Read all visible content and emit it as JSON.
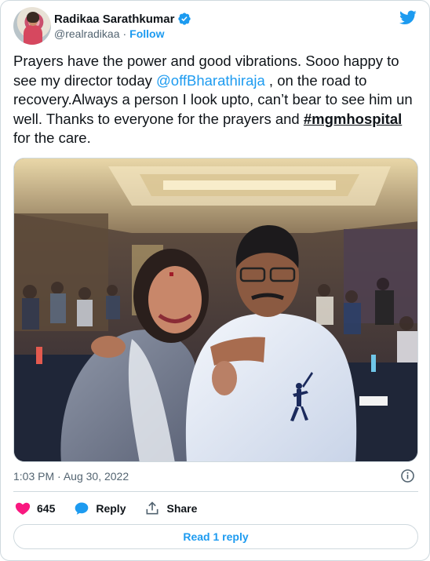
{
  "author": {
    "name": "Radikaa Sarathkumar",
    "handle": "@realradikaa",
    "separator": "·",
    "follow_label": "Follow"
  },
  "tweet": {
    "text_1": "Prayers have the power and good vibrations. Sooo happy to see my director today ",
    "mention": "@offBharathiraja",
    "text_2": " , on the road to recovery.Always a person I look upto, can’t bear to see him un well. Thanks to everyone for the prayers and ",
    "hashtag": "#mgmhospital",
    "text_3": " for the care."
  },
  "meta": {
    "time": "1:03 PM",
    "separator": "·",
    "date": "Aug 30, 2022"
  },
  "actions": {
    "like_count": "645",
    "reply_label": "Reply",
    "share_label": "Share"
  },
  "read_replies_label": "Read 1 reply",
  "icons": {
    "verified": "verified-badge-icon",
    "brand": "twitter-bird-icon",
    "info": "info-icon",
    "like": "heart-icon",
    "reply": "reply-bubble-icon",
    "share": "share-icon"
  },
  "colors": {
    "accent": "#1d9bf0",
    "text": "#0f1419",
    "secondary_text": "#536471",
    "like": "#f91880",
    "border": "#cfd9de"
  }
}
